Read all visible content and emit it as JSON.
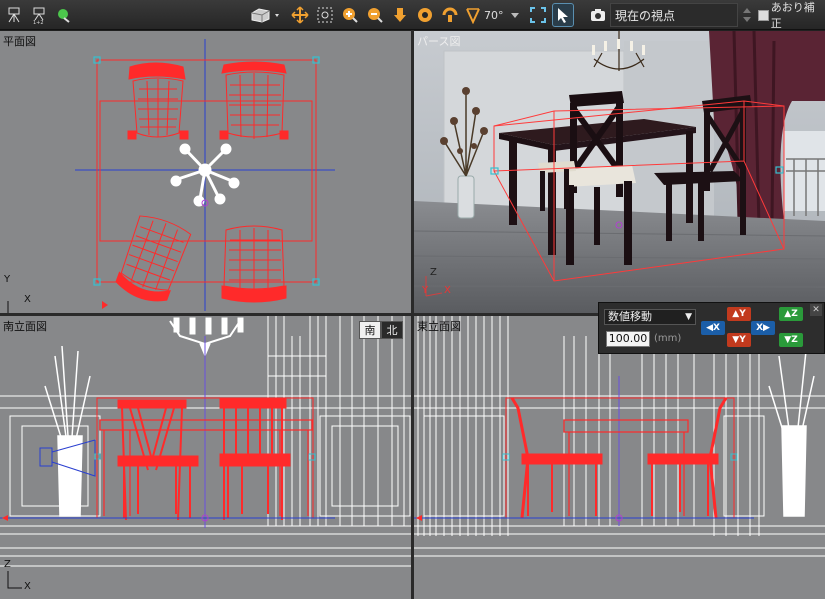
{
  "toolbar": {
    "fov_label": "70°",
    "viewpoint_label": "現在の視点",
    "aori_label": "あおり補正"
  },
  "viewports": {
    "plan": {
      "label": "平面図",
      "axis_y": "Y",
      "axis_x": "X"
    },
    "perspective": {
      "label": "パース図",
      "axis_z": "Z",
      "axis_y": "Y",
      "axis_x": "X"
    },
    "south": {
      "label": "南立面図",
      "axis_z": "Z",
      "axis_x": "X"
    },
    "east": {
      "label": "東立面図"
    }
  },
  "direction_toggle": {
    "south": "南",
    "north": "北"
  },
  "numeric_panel": {
    "mode": "数値移動",
    "value": "100.00",
    "unit": "(mm)",
    "minus_x": "X",
    "plus_x": "X",
    "plus_y": "Y",
    "minus_y": "Y",
    "plus_z": "Z",
    "minus_z": "Z"
  },
  "colors": {
    "selection": "#ff2a2a",
    "wireframe": "#ffffff",
    "axis_blue": "#2a3fd0",
    "handle_cyan": "#36c0d0"
  }
}
